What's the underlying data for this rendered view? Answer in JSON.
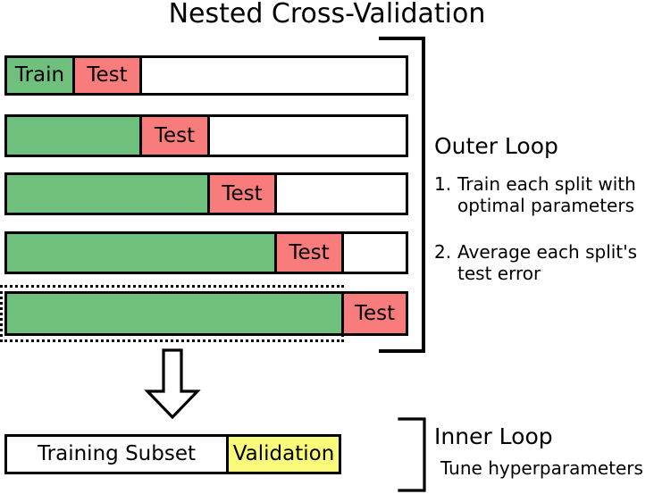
{
  "title": "Nested Cross-Validation",
  "folds": [
    {
      "train_label": "Train",
      "test_label": "Test",
      "train_width_pct": 16.8,
      "test_width_pct": 16.6,
      "remainder_pct": 66.6
    },
    {
      "train_label": "",
      "test_label": "Test",
      "train_width_pct": 33.4,
      "test_width_pct": 16.8,
      "remainder_pct": 49.8
    },
    {
      "train_label": "",
      "test_label": "Test",
      "train_width_pct": 50.2,
      "test_width_pct": 16.6,
      "remainder_pct": 33.2
    },
    {
      "train_label": "",
      "test_label": "Test",
      "train_width_pct": 66.8,
      "test_width_pct": 16.6,
      "remainder_pct": 16.6
    },
    {
      "train_label": "",
      "test_label": "Test",
      "train_width_pct": 83.4,
      "test_width_pct": 16.6,
      "remainder_pct": 0
    }
  ],
  "outer_loop": {
    "heading": "Outer Loop",
    "items": [
      {
        "number": "1.",
        "text": "Train each split with optimal parameters"
      },
      {
        "number": "2.",
        "text": "Average each split's test error"
      }
    ]
  },
  "inner_loop": {
    "heading": "Inner Loop",
    "subtitle": "Tune hyperparameters"
  },
  "inner_split": {
    "training_label": "Training Subset",
    "validation_label": "Validation",
    "training_width_pct": 65.8,
    "validation_width_pct": 34.2
  },
  "colors": {
    "train_green": "#6EC07C",
    "test_red": "#F97C7C",
    "validation_yellow": "#F9F97A",
    "stroke": "#000000",
    "background": "#FFFFFF"
  }
}
